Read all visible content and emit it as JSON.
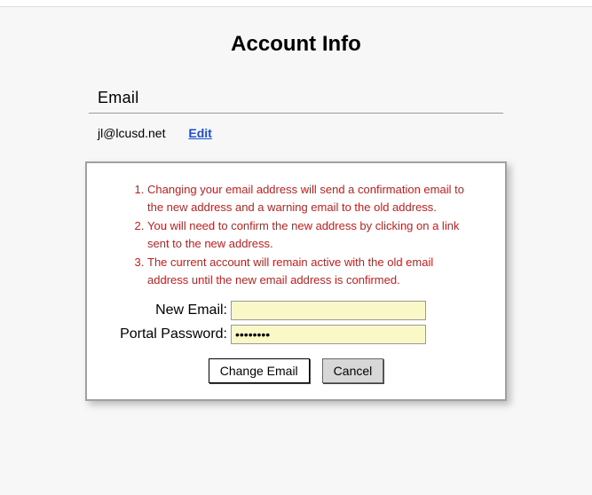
{
  "page": {
    "title": "Account Info"
  },
  "email_section": {
    "header": "Email",
    "current_email": "jl@lcusd.net",
    "edit_label": "Edit"
  },
  "change_panel": {
    "notices": [
      "Changing your email address will send a confirmation email to the new address and a warning email to the old address.",
      "You will need to confirm the new address by clicking on a link sent to the new address.",
      "The current account will remain active with the old email address until the new email address is confirmed."
    ],
    "new_email_label": "New Email:",
    "new_email_value": "",
    "password_label": "Portal Password:",
    "password_value": "••••••••",
    "change_button": "Change Email",
    "cancel_button": "Cancel"
  }
}
